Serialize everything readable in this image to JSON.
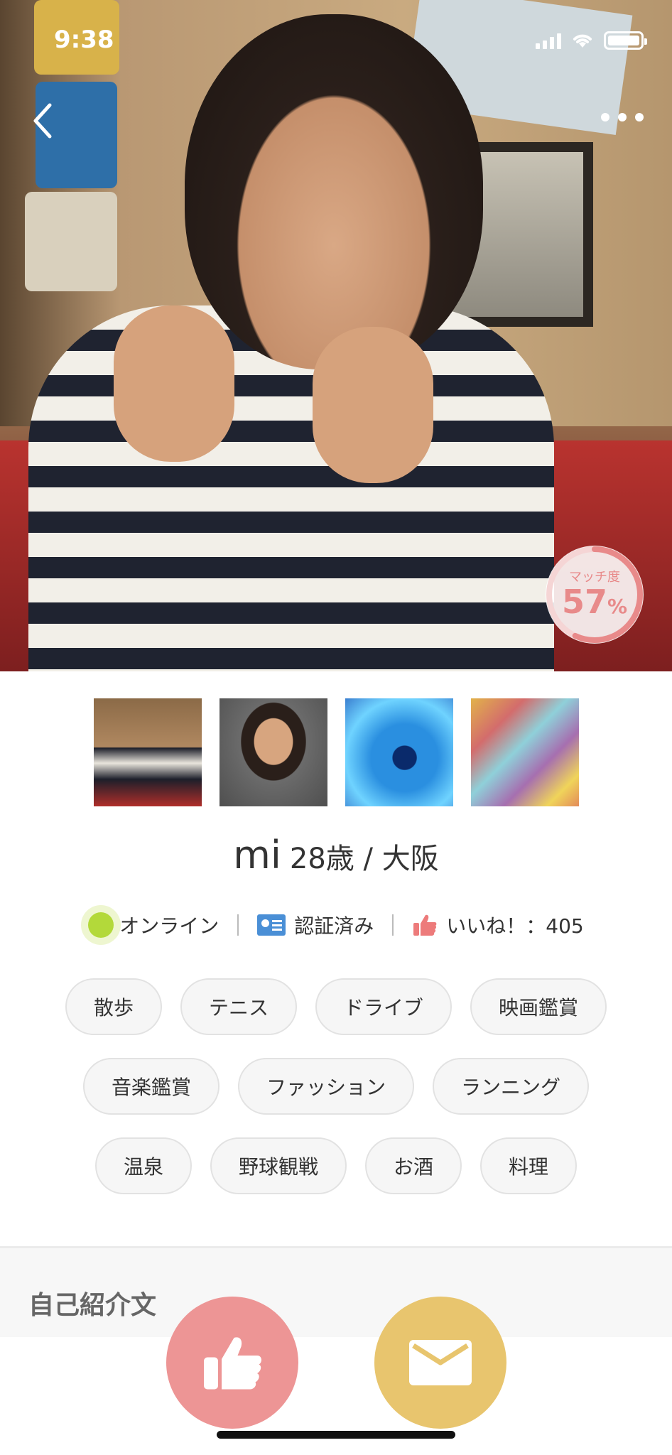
{
  "status_bar": {
    "time": "9:38"
  },
  "match": {
    "label": "マッチ度",
    "value": "57",
    "unit": "%",
    "fraction": 0.57
  },
  "profile": {
    "name": "mi",
    "age_location": "28歳 / 大阪"
  },
  "info": {
    "online": "オンライン",
    "verified": "認証済み",
    "likes": "いいね！：405"
  },
  "tags": [
    [
      "散歩",
      "テニス",
      "ドライブ",
      "映画鑑賞"
    ],
    [
      "音楽鑑賞",
      "ファッション",
      "ランニング"
    ],
    [
      "温泉",
      "野球観戦",
      "お酒",
      "料理"
    ]
  ],
  "section": {
    "title": "自己紹介文"
  },
  "colors": {
    "like": "#ed9595",
    "message": "#e8c56e",
    "online": "#b3d93a",
    "match": "#e88a8a"
  },
  "icons": [
    "back-icon",
    "more-icon",
    "thumbs-up-icon",
    "envelope-icon",
    "id-card-icon"
  ]
}
